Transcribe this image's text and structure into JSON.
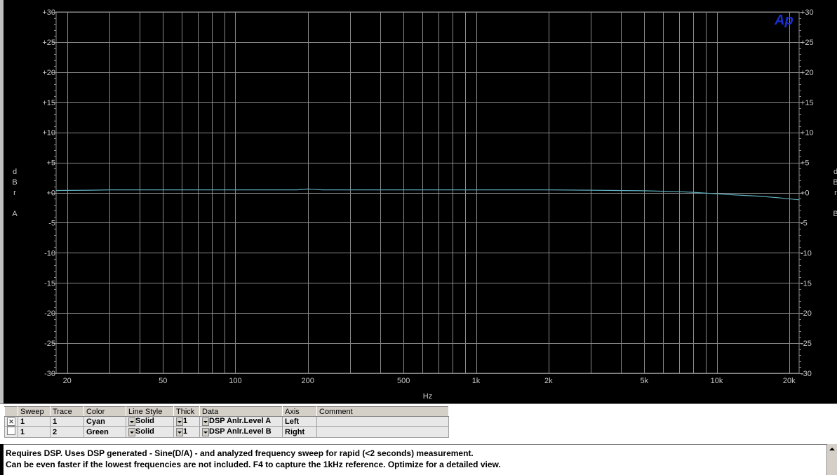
{
  "logo_text": "Ap",
  "chart_data": {
    "type": "line",
    "xscale": "log",
    "xlim": [
      18,
      22000
    ],
    "ylim": [
      -30,
      30
    ],
    "xlabel": "Hz",
    "ylabel_left": [
      "d",
      "B",
      "r",
      "",
      "A"
    ],
    "ylabel_right": [
      "d",
      "B",
      "r",
      "",
      "B"
    ],
    "xticks": [
      {
        "value": 20,
        "label": "20"
      },
      {
        "value": 50,
        "label": "50"
      },
      {
        "value": 100,
        "label": "100"
      },
      {
        "value": 200,
        "label": "200"
      },
      {
        "value": 500,
        "label": "500"
      },
      {
        "value": 1000,
        "label": "1k"
      },
      {
        "value": 2000,
        "label": "2k"
      },
      {
        "value": 5000,
        "label": "5k"
      },
      {
        "value": 10000,
        "label": "10k"
      },
      {
        "value": 20000,
        "label": "20k"
      }
    ],
    "yticks": [
      {
        "value": 30,
        "label": "+30"
      },
      {
        "value": 25,
        "label": "+25"
      },
      {
        "value": 20,
        "label": "+20"
      },
      {
        "value": 15,
        "label": "+15"
      },
      {
        "value": 10,
        "label": "+10"
      },
      {
        "value": 5,
        "label": "+5"
      },
      {
        "value": 0,
        "label": "+0"
      },
      {
        "value": -5,
        "label": "-5"
      },
      {
        "value": -10,
        "label": "-10"
      },
      {
        "value": -15,
        "label": "-15"
      },
      {
        "value": -20,
        "label": "-20"
      },
      {
        "value": -25,
        "label": "-25"
      },
      {
        "value": -30,
        "label": "-30"
      }
    ],
    "grid": true,
    "series": [
      {
        "color": "#5fb0c0",
        "x": [
          18,
          25,
          30,
          50,
          100,
          150,
          180,
          200,
          210,
          230,
          500,
          1000,
          2000,
          3000,
          5000,
          7000,
          8000,
          10000,
          12000,
          15000,
          18000,
          22000
        ],
        "y": [
          0.35,
          0.4,
          0.45,
          0.45,
          0.45,
          0.45,
          0.45,
          0.6,
          0.55,
          0.45,
          0.45,
          0.45,
          0.45,
          0.4,
          0.3,
          0.15,
          0.05,
          -0.2,
          -0.4,
          -0.6,
          -0.85,
          -1.2
        ]
      }
    ]
  },
  "legend": {
    "headers": [
      "",
      "Sweep",
      "Trace",
      "Color",
      "Line Style",
      "Thick",
      "Data",
      "Axis",
      "Comment"
    ],
    "rows": [
      {
        "checked": "✕",
        "sweep": "1",
        "trace": "1",
        "color": "Cyan",
        "style": "Solid",
        "thick": "1",
        "data": "DSP Anlr.Level A",
        "axis": "Left",
        "comment": ""
      },
      {
        "checked": "",
        "sweep": "1",
        "trace": "2",
        "color": "Green",
        "style": "Solid",
        "thick": "1",
        "data": "DSP Anlr.Level B",
        "axis": "Right",
        "comment": ""
      }
    ]
  },
  "comment": {
    "line1": "Requires DSP.  Uses DSP generated - Sine(D/A) - and analyzed frequency sweep for rapid (<2 seconds) measurement.",
    "line2": "Can be even faster if the lowest frequencies are not included. F4 to capture the 1kHz reference. Optimize for a detailed view."
  }
}
